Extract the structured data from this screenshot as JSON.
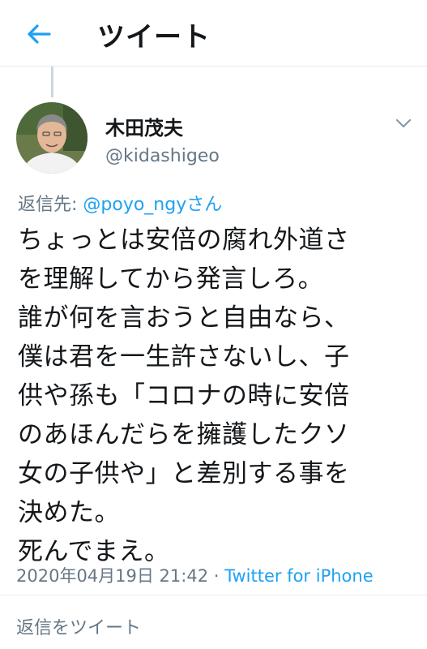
{
  "header": {
    "title": "ツイート",
    "back_icon": "back-arrow-icon",
    "accent": "#1da1f2"
  },
  "tweet": {
    "author": {
      "display_name": "木田茂夫",
      "handle": "@kidashigeo"
    },
    "reply_to_label": "返信先: ",
    "reply_to_mention": "@poyo_ngyさん",
    "text_lines": [
      "ちょっとは安倍の腐れ外道さ",
      "を理解してから発言しろ。",
      "誰が何を言おうと自由なら、",
      "僕は君を一生許さないし、子",
      "供や孫も「コロナの時に安倍",
      "のあほんだらを擁護したクソ",
      "女の子供や」と差別する事を",
      "決めた。",
      "死んでまえ。"
    ],
    "timestamp": "2020年04月19日 21:42",
    "separator": " · ",
    "source": "Twitter for iPhone"
  },
  "reply_composer": {
    "placeholder": "返信をツイート"
  }
}
